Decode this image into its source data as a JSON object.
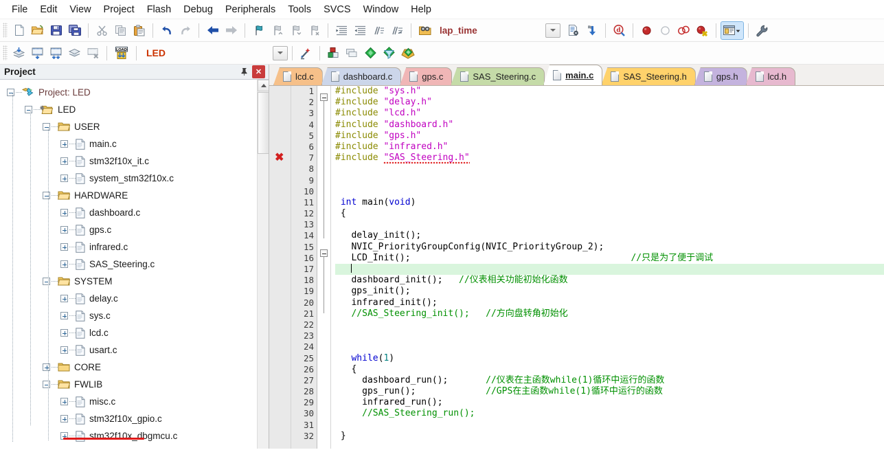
{
  "menu": {
    "items": [
      "File",
      "Edit",
      "View",
      "Project",
      "Flash",
      "Debug",
      "Peripherals",
      "Tools",
      "SVCS",
      "Window",
      "Help"
    ]
  },
  "toolbar_main": {
    "buttons": [
      {
        "name": "new-file",
        "icon": "new-document-icon",
        "title": "New"
      },
      {
        "name": "open-file",
        "icon": "open-folder-icon",
        "title": "Open"
      },
      {
        "name": "save-file",
        "icon": "save-floppy-icon",
        "title": "Save"
      },
      {
        "name": "save-all",
        "icon": "save-all-icon",
        "title": "Save All"
      },
      {
        "name": "cut",
        "icon": "scissors-icon",
        "title": "Cut"
      },
      {
        "name": "copy",
        "icon": "copy-icon",
        "title": "Copy"
      },
      {
        "name": "paste",
        "icon": "paste-icon",
        "title": "Paste"
      },
      {
        "name": "undo",
        "icon": "undo-arrow-icon",
        "title": "Undo"
      },
      {
        "name": "redo",
        "icon": "redo-arrow-icon",
        "title": "Redo"
      },
      {
        "name": "navigate-back",
        "icon": "arrow-left-icon",
        "title": "Back"
      },
      {
        "name": "navigate-forward",
        "icon": "arrow-right-icon",
        "title": "Forward"
      },
      {
        "name": "bookmark-toggle",
        "icon": "bookmark-flag-icon",
        "title": "Toggle Bookmark"
      },
      {
        "name": "bookmark-prev",
        "icon": "bookmark-prev-icon",
        "title": "Previous Bookmark"
      },
      {
        "name": "bookmark-next",
        "icon": "bookmark-next-icon",
        "title": "Next Bookmark"
      },
      {
        "name": "bookmark-clear",
        "icon": "bookmark-clear-icon",
        "title": "Clear Bookmarks"
      },
      {
        "name": "indent-right",
        "icon": "indent-right-icon",
        "title": "Indent"
      },
      {
        "name": "indent-left",
        "icon": "indent-left-icon",
        "title": "Outdent"
      },
      {
        "name": "comment-block",
        "icon": "comment-lines-icon",
        "title": "Comment"
      },
      {
        "name": "uncomment-block",
        "icon": "uncomment-lines-icon",
        "title": "Uncomment"
      },
      {
        "name": "find-in-files",
        "icon": "binoculars-folder-icon",
        "title": "Find in Files"
      }
    ],
    "search_value": "lap_time",
    "search_placeholder": "",
    "right_buttons": [
      {
        "name": "insert-file",
        "icon": "document-gear-icon",
        "title": "Insert/Remove"
      },
      {
        "name": "jump-to-definition",
        "icon": "blue-down-arrow-icon",
        "title": "Go To Definition"
      },
      {
        "name": "start-debug-session",
        "icon": "debug-magnifier-icon",
        "title": "Start/Stop Debug Session"
      },
      {
        "name": "insert-breakpoint",
        "icon": "red-breakpoint-icon",
        "title": "Insert/Remove Breakpoint"
      },
      {
        "name": "enable-breakpoint",
        "icon": "hollow-breakpoint-icon",
        "title": "Enable/Disable Breakpoint"
      },
      {
        "name": "disable-all-breakpoints",
        "icon": "disable-breakpoints-icon",
        "title": "Disable All Breakpoints"
      },
      {
        "name": "kill-all-breakpoints",
        "icon": "kill-breakpoints-icon",
        "title": "Kill All Breakpoints"
      },
      {
        "name": "project-windows",
        "icon": "window-layout-icon",
        "title": "Project Windows"
      },
      {
        "name": "configuration-wizard",
        "icon": "wrench-icon",
        "title": "Configuration Wizard"
      }
    ]
  },
  "toolbar_build": {
    "buttons": [
      {
        "name": "translate-file",
        "icon": "translate-layers-icon",
        "title": "Translate"
      },
      {
        "name": "build-target",
        "icon": "build-target-icon",
        "title": "Build"
      },
      {
        "name": "rebuild-all",
        "icon": "rebuild-all-icon",
        "title": "Rebuild"
      },
      {
        "name": "batch-build",
        "icon": "batch-build-icon",
        "title": "Batch Build"
      },
      {
        "name": "stop-build",
        "icon": "stop-build-icon",
        "title": "Stop Build"
      },
      {
        "name": "download-to-flash",
        "icon": "load-flash-icon",
        "title": "Download"
      }
    ],
    "target_value": "LED",
    "right_buttons": [
      {
        "name": "target-options-wizard",
        "icon": "magic-wand-icon",
        "title": "Options Wizard"
      },
      {
        "name": "manage-project-items",
        "icon": "manage-components-icon",
        "title": "Manage Project Items"
      },
      {
        "name": "manage-multi-project",
        "icon": "multi-project-icon",
        "title": "Multi-Project"
      },
      {
        "name": "manage-run-time-env",
        "icon": "green-diamond-icon",
        "title": "Run-Time Environment"
      },
      {
        "name": "select-software-packs",
        "icon": "pack-filter-icon",
        "title": "Select Software Packs"
      },
      {
        "name": "pack-installer",
        "icon": "pack-installer-icon",
        "title": "Pack Installer"
      }
    ]
  },
  "project_panel": {
    "title": "Project",
    "pin_icon": "pin-icon",
    "close_icon": "close-x-icon",
    "tree": [
      {
        "label": "Project: LED",
        "depth": 0,
        "state": "minus",
        "icon": "project-icon",
        "color": "#6a3b3b"
      },
      {
        "label": "LED",
        "depth": 1,
        "state": "minus",
        "icon": "target-folder-icon"
      },
      {
        "label": "USER",
        "depth": 2,
        "state": "minus",
        "icon": "open-folder-icon"
      },
      {
        "label": "main.c",
        "depth": 3,
        "state": "plus",
        "icon": "c-file-icon"
      },
      {
        "label": "stm32f10x_it.c",
        "depth": 3,
        "state": "plus",
        "icon": "c-file-icon"
      },
      {
        "label": "system_stm32f10x.c",
        "depth": 3,
        "state": "plus",
        "icon": "c-file-icon"
      },
      {
        "label": "HARDWARE",
        "depth": 2,
        "state": "minus",
        "icon": "open-folder-icon"
      },
      {
        "label": "dashboard.c",
        "depth": 3,
        "state": "plus",
        "icon": "c-file-icon"
      },
      {
        "label": "gps.c",
        "depth": 3,
        "state": "plus",
        "icon": "c-file-icon"
      },
      {
        "label": "infrared.c",
        "depth": 3,
        "state": "plus",
        "icon": "c-file-icon"
      },
      {
        "label": "SAS_Steering.c",
        "depth": 3,
        "state": "plus",
        "icon": "c-file-icon"
      },
      {
        "label": "SYSTEM",
        "depth": 2,
        "state": "minus",
        "icon": "open-folder-icon"
      },
      {
        "label": "delay.c",
        "depth": 3,
        "state": "plus",
        "icon": "c-file-icon"
      },
      {
        "label": "sys.c",
        "depth": 3,
        "state": "plus",
        "icon": "c-file-icon"
      },
      {
        "label": "lcd.c",
        "depth": 3,
        "state": "plus",
        "icon": "c-file-icon"
      },
      {
        "label": "usart.c",
        "depth": 3,
        "state": "plus",
        "icon": "c-file-icon"
      },
      {
        "label": "CORE",
        "depth": 2,
        "state": "plus",
        "icon": "closed-folder-icon"
      },
      {
        "label": "FWLIB",
        "depth": 2,
        "state": "minus",
        "icon": "open-folder-icon"
      },
      {
        "label": "misc.c",
        "depth": 3,
        "state": "plus",
        "icon": "c-file-icon"
      },
      {
        "label": "stm32f10x_gpio.c",
        "depth": 3,
        "state": "plus",
        "icon": "c-file-icon"
      },
      {
        "label": "stm32f10x_dbgmcu.c",
        "depth": 3,
        "state": "plus",
        "icon": "c-file-icon"
      }
    ],
    "annotation": {
      "name": "red-underline-annotation",
      "color": "#e01b1b"
    }
  },
  "editor": {
    "tabs": [
      {
        "label": "lcd.c",
        "color": "#f6c089",
        "active": false
      },
      {
        "label": "dashboard.c",
        "color": "#ccd6ea",
        "active": false
      },
      {
        "label": "gps.c",
        "color": "#f0b6b6",
        "active": false
      },
      {
        "label": "SAS_Steering.c",
        "color": "#c5dba8",
        "active": false
      },
      {
        "label": "main.c",
        "color": "#ffffff",
        "active": true
      },
      {
        "label": "SAS_Steering.h",
        "color": "#ffd26b",
        "active": false
      },
      {
        "label": "gps.h",
        "color": "#c4b3de",
        "active": false
      },
      {
        "label": "lcd.h",
        "color": "#e7b9cf",
        "active": false
      }
    ],
    "error_marker": {
      "name": "error-x-marker",
      "line": 7,
      "glyph": "✖",
      "color": "#d21f1f"
    },
    "first_line": 1,
    "last_line": 32,
    "current_line": 17,
    "code": [
      {
        "n": 1,
        "tokens": [
          {
            "t": "#include ",
            "c": "pre"
          },
          {
            "t": "\"sys.h\"",
            "c": "str"
          }
        ]
      },
      {
        "n": 2,
        "tokens": [
          {
            "t": "#include ",
            "c": "pre"
          },
          {
            "t": "\"delay.h\"",
            "c": "str"
          }
        ]
      },
      {
        "n": 3,
        "tokens": [
          {
            "t": "#include ",
            "c": "pre"
          },
          {
            "t": "\"lcd.h\"",
            "c": "str"
          }
        ]
      },
      {
        "n": 4,
        "tokens": [
          {
            "t": "#include ",
            "c": "pre"
          },
          {
            "t": "\"dashboard.h\"",
            "c": "str"
          }
        ]
      },
      {
        "n": 5,
        "tokens": [
          {
            "t": "#include ",
            "c": "pre"
          },
          {
            "t": "\"gps.h\"",
            "c": "str"
          }
        ]
      },
      {
        "n": 6,
        "tokens": [
          {
            "t": "#include ",
            "c": "pre"
          },
          {
            "t": "\"infrared.h\"",
            "c": "str"
          }
        ]
      },
      {
        "n": 7,
        "tokens": [
          {
            "t": "#include ",
            "c": "pre"
          },
          {
            "t": "\"SAS_Steering.h\"",
            "c": "str sq"
          }
        ]
      },
      {
        "n": 8,
        "tokens": []
      },
      {
        "n": 9,
        "tokens": []
      },
      {
        "n": 10,
        "tokens": []
      },
      {
        "n": 11,
        "tokens": [
          {
            "t": " ",
            "c": ""
          },
          {
            "t": "int",
            "c": "kw"
          },
          {
            "t": " main(",
            "c": ""
          },
          {
            "t": "void",
            "c": "kw"
          },
          {
            "t": ")",
            "c": ""
          }
        ]
      },
      {
        "n": 12,
        "tokens": [
          {
            "t": " {",
            "c": ""
          }
        ]
      },
      {
        "n": 13,
        "tokens": []
      },
      {
        "n": 14,
        "tokens": [
          {
            "t": "   delay_init();",
            "c": ""
          }
        ]
      },
      {
        "n": 15,
        "tokens": [
          {
            "t": "   NVIC_PriorityGroupConfig(NVIC_PriorityGroup_2);",
            "c": ""
          }
        ]
      },
      {
        "n": 16,
        "tokens": [
          {
            "t": "   LCD_Init();",
            "c": ""
          },
          {
            "t": "                                         ",
            "c": ""
          },
          {
            "t": "//只是为了便于调试",
            "c": "cmt"
          }
        ]
      },
      {
        "n": 17,
        "tokens": [
          {
            "t": "   ",
            "c": ""
          }
        ]
      },
      {
        "n": 18,
        "tokens": [
          {
            "t": "   dashboard_init();   ",
            "c": ""
          },
          {
            "t": "//仪表相关功能初始化函数",
            "c": "cmt"
          }
        ]
      },
      {
        "n": 19,
        "tokens": [
          {
            "t": "   gps_init();",
            "c": ""
          }
        ]
      },
      {
        "n": 20,
        "tokens": [
          {
            "t": "   infrared_init();",
            "c": ""
          }
        ]
      },
      {
        "n": 21,
        "tokens": [
          {
            "t": "   ",
            "c": ""
          },
          {
            "t": "//SAS_Steering_init();   //方向盘转角初始化",
            "c": "cmt"
          }
        ]
      },
      {
        "n": 22,
        "tokens": []
      },
      {
        "n": 23,
        "tokens": []
      },
      {
        "n": 24,
        "tokens": []
      },
      {
        "n": 25,
        "tokens": [
          {
            "t": "   ",
            "c": ""
          },
          {
            "t": "while",
            "c": "kw"
          },
          {
            "t": "(",
            "c": ""
          },
          {
            "t": "1",
            "c": "num"
          },
          {
            "t": ")",
            "c": ""
          }
        ]
      },
      {
        "n": 26,
        "tokens": [
          {
            "t": "   {",
            "c": ""
          }
        ]
      },
      {
        "n": 27,
        "tokens": [
          {
            "t": "     dashboard_run();       ",
            "c": ""
          },
          {
            "t": "//仪表在主函数while(1)循环中运行的函数",
            "c": "cmt"
          }
        ]
      },
      {
        "n": 28,
        "tokens": [
          {
            "t": "     gps_run();             ",
            "c": ""
          },
          {
            "t": "//GPS在主函数while(1)循环中运行的函数",
            "c": "cmt"
          }
        ]
      },
      {
        "n": 29,
        "tokens": [
          {
            "t": "     infrared_run();",
            "c": ""
          }
        ]
      },
      {
        "n": 30,
        "tokens": [
          {
            "t": "     ",
            "c": ""
          },
          {
            "t": "//SAS_Steering_run();",
            "c": "cmt"
          }
        ]
      },
      {
        "n": 31,
        "tokens": []
      },
      {
        "n": 32,
        "tokens": [
          {
            "t": " }",
            "c": ""
          }
        ]
      }
    ]
  },
  "colors": {
    "keyword": "#0000d0",
    "preprocessor": "#8a8a00",
    "string": "#c000c0",
    "comment": "#009000",
    "number": "#008080",
    "current_line_highlight": "#d9f5dd",
    "error": "#d21f1f",
    "target_text": "#cc3300",
    "search_text": "#993333"
  }
}
